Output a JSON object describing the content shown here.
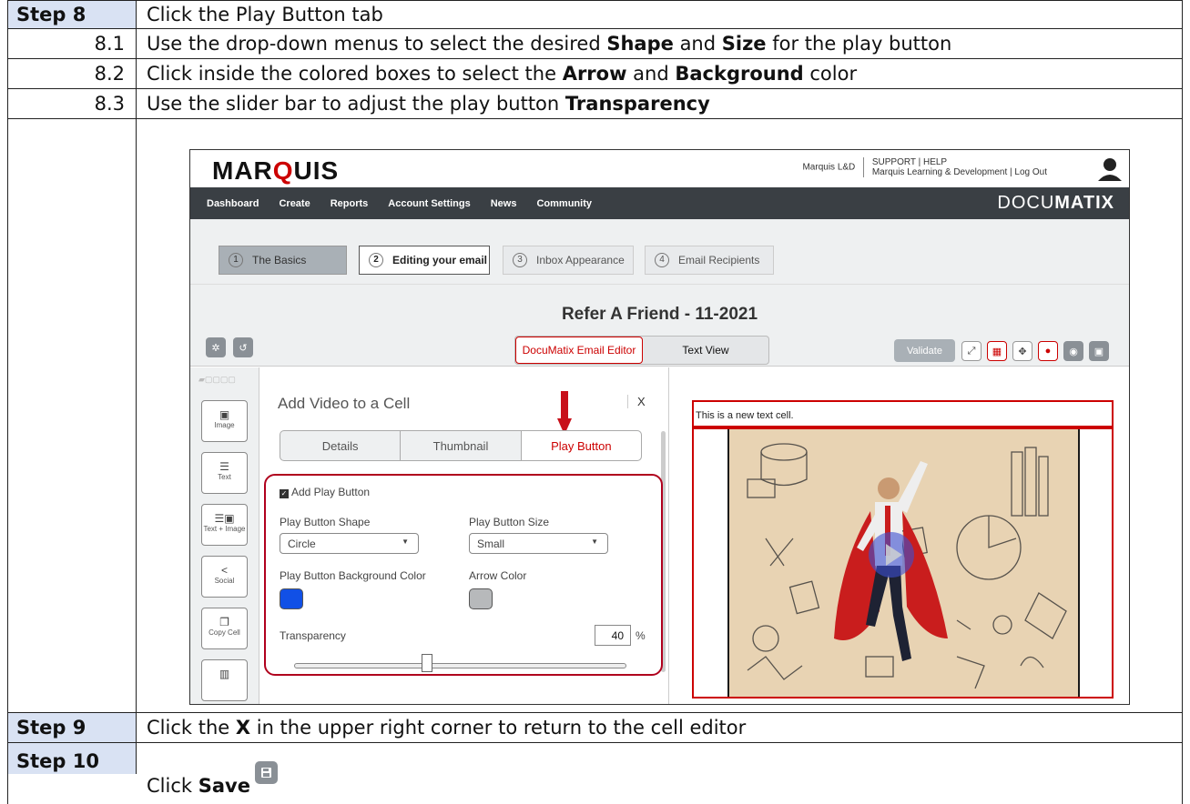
{
  "doc": {
    "step8": {
      "label": "Step 8",
      "text": "Click the Play Button tab"
    },
    "s81": {
      "label": "8.1",
      "pre": "Use the drop-down menus to select the desired ",
      "b1": "Shape",
      "mid": " and ",
      "b2": "Size",
      "post": " for the play button"
    },
    "s82": {
      "label": "8.2",
      "pre": "Click inside the colored boxes to select the ",
      "b1": "Arrow",
      "mid": " and ",
      "b2": "Background",
      "post": " color"
    },
    "s83": {
      "label": "8.3",
      "pre": "Use the slider bar to adjust the play button ",
      "b1": "Transparency"
    },
    "step9": {
      "label": "Step 9",
      "pre": "Click the ",
      "b1": "X",
      "post": " in the upper right corner to return to the cell editor"
    },
    "step10": {
      "label": "Step 10",
      "pre": "Click ",
      "b1": "Save"
    }
  },
  "app": {
    "logo": "MARQUIS",
    "user": "Marquis L&D",
    "support": "SUPPORT | HELP",
    "account": "Marquis Learning & Development | Log Out",
    "nav": [
      "Dashboard",
      "Create",
      "Reports",
      "Account Settings",
      "News",
      "Community"
    ],
    "brand_pre": "DOCU",
    "brand_bold": "MATIX",
    "steps": [
      {
        "num": "1",
        "label": "The Basics"
      },
      {
        "num": "2",
        "label": "Editing your email"
      },
      {
        "num": "3",
        "label": "Inbox Appearance"
      },
      {
        "num": "4",
        "label": "Email Recipients"
      }
    ],
    "email_title": "Refer A Friend - 11-2021",
    "toggle": {
      "editor": "DocuMatix Email Editor",
      "text": "Text View"
    },
    "validate": "Validate",
    "tools": [
      {
        "icon": "image-icon",
        "label": "Image"
      },
      {
        "icon": "text-icon",
        "label": "Text"
      },
      {
        "icon": "text-image-icon",
        "label": "Text + Image"
      },
      {
        "icon": "social-icon",
        "label": "Social"
      },
      {
        "icon": "copy-cell-icon",
        "label": "Copy Cell"
      }
    ],
    "panel": {
      "title": "Add Video to a Cell",
      "close": "X",
      "tabs": [
        "Details",
        "Thumbnail",
        "Play Button"
      ],
      "add_play": "Add Play Button",
      "shape_label": "Play Button Shape",
      "shape_value": "Circle",
      "size_label": "Play Button Size",
      "size_value": "Small",
      "bg_label": "Play Button Background Color",
      "arrow_label": "Arrow Color",
      "bg_color": "#1150e6",
      "arrow_color": "#b7b9bb",
      "transparency_label": "Transparency",
      "transparency_value": "40",
      "pct_sign": "%",
      "slider_fraction": 0.4
    },
    "preview": {
      "text_cell": "This is a new text cell."
    }
  }
}
